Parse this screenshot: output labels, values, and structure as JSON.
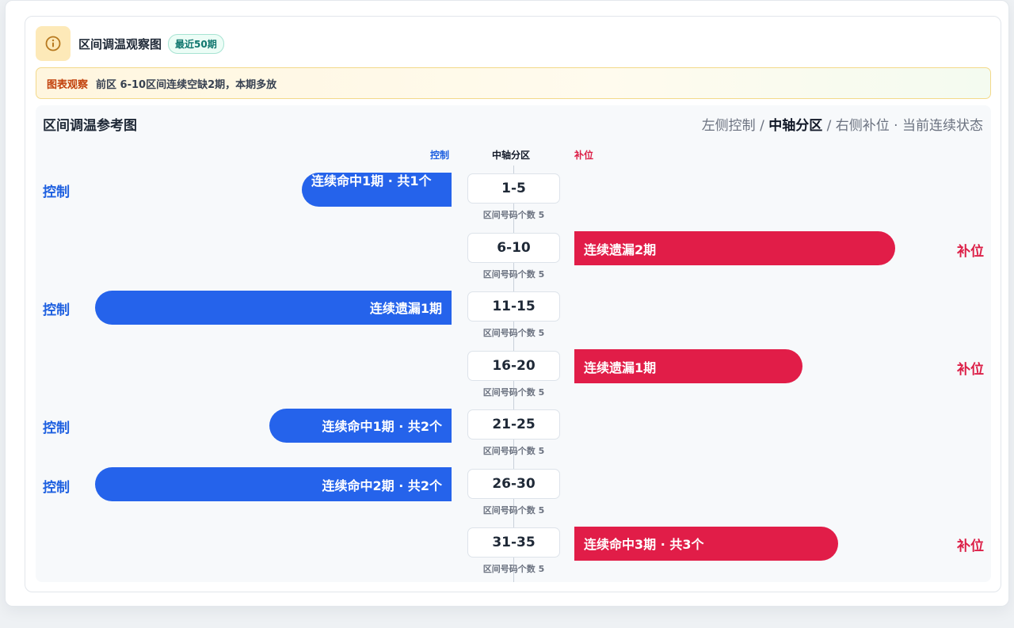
{
  "header": {
    "title": "区间调温观察图",
    "badge": "最近50期"
  },
  "observation": {
    "label": "图表观察",
    "text": "前区 6-10区间连续空缺2期，本期多放"
  },
  "panel": {
    "title": "区间调温参考图",
    "legend": {
      "left": "左侧控制",
      "sep1": " / ",
      "middle": "中轴分区",
      "sep2": " / ",
      "right": "右侧补位",
      "dot": " · ",
      "tail": "当前连续状态"
    },
    "columns": {
      "left": "控制",
      "center": "中轴分区",
      "right": "补位"
    }
  },
  "colors": {
    "control": "#2563eb",
    "fill": "#e11d48",
    "badge": "#0f766e",
    "observe": "#c2410c"
  },
  "icons": {
    "info": "info-circle-icon"
  },
  "zones": [
    {
      "range": "1-5",
      "count_text": "区间号码个数 5",
      "side": "left",
      "side_label": "控制",
      "bar_text": "连续命中1期 · 共1个",
      "bar_level": 0.42
    },
    {
      "range": "6-10",
      "count_text": "区间号码个数 5",
      "side": "right",
      "side_label": "补位",
      "bar_text": "连续遗漏2期",
      "bar_level": 0.9
    },
    {
      "range": "11-15",
      "count_text": "区间号码个数 5",
      "side": "left",
      "side_label": "控制",
      "bar_text": "连续遗漏1期",
      "bar_level": 1.0
    },
    {
      "range": "16-20",
      "count_text": "区间号码个数 5",
      "side": "right",
      "side_label": "补位",
      "bar_text": "连续遗漏1期",
      "bar_level": 0.64
    },
    {
      "range": "21-25",
      "count_text": "区间号码个数 5",
      "side": "left",
      "side_label": "控制",
      "bar_text": "连续命中1期 · 共2个",
      "bar_level": 0.51
    },
    {
      "range": "26-30",
      "count_text": "区间号码个数 5",
      "side": "left",
      "side_label": "控制",
      "bar_text": "连续命中2期 · 共2个",
      "bar_level": 1.0
    },
    {
      "range": "31-35",
      "count_text": "区间号码个数 5",
      "side": "right",
      "side_label": "补位",
      "bar_text": "连续命中3期 · 共3个",
      "bar_level": 0.74
    }
  ]
}
